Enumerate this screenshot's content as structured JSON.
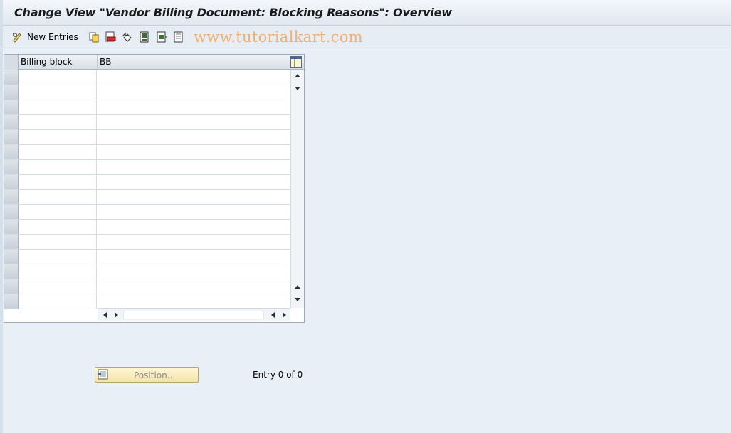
{
  "window": {
    "title": "Change View \"Vendor Billing Document: Blocking Reasons\": Overview"
  },
  "toolbar": {
    "new_entries_label": "New Entries",
    "icons": [
      "edit-glasses-icon",
      "copy-icon",
      "delete-icon",
      "undo-icon",
      "select-all-icon",
      "select-block-icon",
      "deselect-all-icon"
    ]
  },
  "watermark": "www.tutorialkart.com",
  "table": {
    "columns": [
      "Billing block",
      "BB"
    ],
    "row_count": 16,
    "rows": []
  },
  "footer": {
    "position_label": "Position...",
    "entry_text": "Entry 0 of 0"
  },
  "colors": {
    "background": "#e9eff6",
    "watermark": "#f0b070",
    "position_button": "#f4e4a6"
  }
}
